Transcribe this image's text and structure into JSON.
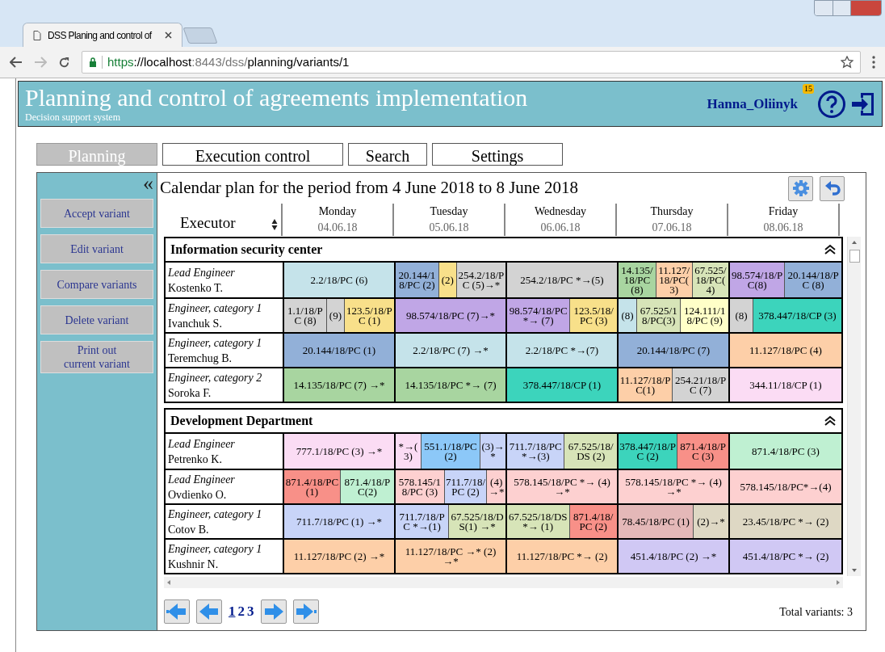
{
  "browser": {
    "tab_title": "DSS Planing and control of",
    "url": [
      {
        "kind": "scheme",
        "text": "https"
      },
      {
        "kind": "host",
        "text": "://localhost"
      },
      {
        "kind": "dim",
        "text": ":8443/dss/"
      },
      {
        "kind": "path",
        "text": "planning/variants/1"
      }
    ]
  },
  "header": {
    "title": "Planning and control of agreements implementation",
    "subtitle": "Decision support system",
    "user": "Hanna_Oliinyk",
    "notifications": "15"
  },
  "nav": [
    {
      "label": "Planning",
      "selected": true
    },
    {
      "label": "Execution control",
      "selected": false
    },
    {
      "label": "Search",
      "selected": false
    },
    {
      "label": "Settings",
      "selected": false
    }
  ],
  "sidebar": {
    "collapse": "«",
    "buttons": [
      "Accept variant",
      "Edit variant",
      "Compare variants",
      "Delete variant",
      "Print out\ncurrent variant"
    ]
  },
  "plan": {
    "title": "Calendar plan for the period from 4 June 2018 to 8 June 2018",
    "executor_label": "Executor",
    "days": [
      {
        "day": "Monday",
        "date": "04.06.18"
      },
      {
        "day": "Tuesday",
        "date": "05.06.18"
      },
      {
        "day": "Wednesday",
        "date": "06.06.18"
      },
      {
        "day": "Thursday",
        "date": "07.06.18"
      },
      {
        "day": "Friday",
        "date": "08.06.18"
      }
    ],
    "groups": [
      {
        "name": "Information security center",
        "expanded": true,
        "rows": [
          {
            "position": "Lead Engineer",
            "name": "Kostenko T.",
            "days": [
              [
                {
                  "text": "2.2/18/PC (6)",
                  "color": "#c5e3ea"
                }
              ],
              [
                {
                  "text": "20.144/18/PC (2)",
                  "color": "#92b0d8"
                },
                {
                  "text": "(2)",
                  "color": "#f8e08a"
                },
                {
                  "text": "254.2/18/PC (5)→*",
                  "color": "#d3d3d3"
                }
              ],
              [
                {
                  "text": "254.2/18/PC *→(5)",
                  "color": "#d3d3d3"
                }
              ],
              [
                {
                  "text": "14.135/18/PC (8)",
                  "color": "#a8d5a0"
                },
                {
                  "text": "11.127/18/PC(3)",
                  "color": "#fdcfa8"
                },
                {
                  "text": "67.525/18/PC(4)",
                  "color": "#d7e4b8"
                }
              ],
              [
                {
                  "text": "98.574/18/PC(8)",
                  "color": "#c0a6e6"
                },
                {
                  "text": "20.144/18/PC (8)",
                  "color": "#92b0d8"
                }
              ]
            ]
          },
          {
            "position": "Engineer, category 1",
            "name": "Ivanchuk S.",
            "days": [
              [
                {
                  "text": "1.1/18/PC (8)",
                  "color": "#d3d3d3"
                },
                {
                  "text": "(9)",
                  "color": "#d3d3d3"
                },
                {
                  "text": "123.5/18/PC (1)",
                  "color": "#f8e08a"
                }
              ],
              [
                {
                  "text": "98.574/18/PC (7)→*",
                  "color": "#c0a6e6"
                }
              ],
              [
                {
                  "text": "98.574/18/PC *→ (7)",
                  "color": "#c0a6e6"
                },
                {
                  "text": "123.5/18/PC (3)",
                  "color": "#f8e08a"
                }
              ],
              [
                {
                  "text": "(8)",
                  "color": "#c5e3ea"
                },
                {
                  "text": "67.525/18/PC(3)",
                  "color": "#d7e4b8"
                },
                {
                  "text": "124.111/18/PC (9)",
                  "color": "#ffffc8"
                }
              ],
              [
                {
                  "text": "(8)",
                  "color": "#d3d3d3"
                },
                {
                  "text": "378.447/18/CP (3)",
                  "color": "#3cd4bc"
                }
              ]
            ]
          },
          {
            "position": "Engineer, category 1",
            "name": "Teremchug B.",
            "days": [
              [
                {
                  "text": "20.144/18/PC (1)",
                  "color": "#92b0d8"
                }
              ],
              [
                {
                  "text": "2.2/18/PC (7) →*",
                  "color": "#c5e3ea"
                }
              ],
              [
                {
                  "text": "2.2/18/PC *→(7)",
                  "color": "#c5e3ea"
                }
              ],
              [
                {
                  "text": "20.144/18/PC (7)",
                  "color": "#92b0d8"
                }
              ],
              [
                {
                  "text": "11.127/18/PC (4)",
                  "color": "#fdcfa8"
                }
              ]
            ]
          },
          {
            "position": "Engineer, category 2",
            "name": "Soroka F.",
            "days": [
              [
                {
                  "text": "14.135/18/PC (7) →*",
                  "color": "#a8d5a0"
                }
              ],
              [
                {
                  "text": "14.135/18/PC *→ (7)",
                  "color": "#a8d5a0"
                }
              ],
              [
                {
                  "text": "378.447/18/CP (1)",
                  "color": "#3cd4bc"
                }
              ],
              [
                {
                  "text": "11.127/18/PC(1)",
                  "color": "#fdcfa8"
                },
                {
                  "text": "254.21/18/PC (7)",
                  "color": "#d3d3d3"
                }
              ],
              [
                {
                  "text": "344.11/18/CP (1)",
                  "color": "#fbdcf4"
                }
              ]
            ]
          }
        ]
      },
      {
        "name": "Development Department",
        "expanded": true,
        "rows": [
          {
            "position": "Lead Engineer",
            "name": "Petrenko K.",
            "days": [
              [
                {
                  "text": "777.1/18/PC (3) →*",
                  "color": "#fbdcf4"
                }
              ],
              [
                {
                  "text": "*→(3)",
                  "color": "#fbdcf4"
                },
                {
                  "text": "551.1/18/PC (2)",
                  "color": "#8cc8f8"
                },
                {
                  "text": "(3)→*",
                  "color": "#c8d4f8"
                }
              ],
              [
                {
                  "text": "711.7/18/PC*→(3)",
                  "color": "#c8d4f8"
                },
                {
                  "text": "67.525/18/DS (2)",
                  "color": "#d7e4b8"
                }
              ],
              [
                {
                  "text": "378.447/18/PC (2)",
                  "color": "#3cd4bc"
                },
                {
                  "text": "871.4/18/PC (3)",
                  "color": "#f89088"
                }
              ],
              [
                {
                  "text": "871.4/18/PC (3)",
                  "color": "#bff0d2"
                }
              ]
            ]
          },
          {
            "position": "Lead Engineer",
            "name": "Ovdienko O.",
            "days": [
              [
                {
                  "text": "871.4/18/PC (1)",
                  "color": "#f89088"
                },
                {
                  "text": "871.4/18/PC(2)",
                  "color": "#bff0d2"
                }
              ],
              [
                {
                  "text": "578.145/18/PC (3)",
                  "color": "#fdd0d0"
                },
                {
                  "text": "711.7/18/PC (2)",
                  "color": "#c8d4f8"
                },
                {
                  "text": "(4)→*",
                  "color": "#fdd0d0"
                }
              ],
              [
                {
                  "text": "578.145/18/PC *→ (4) →*",
                  "color": "#fdd0d0"
                }
              ],
              [
                {
                  "text": "578.145/18/PC *→ (4) →*",
                  "color": "#fdd0d0"
                }
              ],
              [
                {
                  "text": "578.145/18/PC*→(4)",
                  "color": "#fdd0d0"
                }
              ]
            ]
          },
          {
            "position": "Engineer, category 1",
            "name": "Cotov B.",
            "days": [
              [
                {
                  "text": "711.7/18/PC (1) →*",
                  "color": "#c8d4f8"
                }
              ],
              [
                {
                  "text": "711.7/18/PC *→(1)",
                  "color": "#c8d4f8"
                },
                {
                  "text": "67.525/18/DS(1) →*",
                  "color": "#d7e4b8"
                }
              ],
              [
                {
                  "text": "67.525/18/DS*→ (1)",
                  "color": "#d7e4b8"
                },
                {
                  "text": "871.4/18/PC (2)",
                  "color": "#f89088"
                }
              ],
              [
                {
                  "text": "78.45/18/PC (1)",
                  "color": "#e4b8b8"
                },
                {
                  "text": "(2)→*",
                  "color": "#ded8c4"
                }
              ],
              [
                {
                  "text": "23.45/18/PC *→ (2)",
                  "color": "#ded8c4"
                }
              ]
            ]
          },
          {
            "position": "Engineer, category 1",
            "name": "Kushnir N.",
            "days": [
              [
                {
                  "text": "11.127/18/PC (2) →*",
                  "color": "#fdcfa8"
                }
              ],
              [
                {
                  "text": "11.127/18/PC →* (2) →*",
                  "color": "#fdcfa8"
                }
              ],
              [
                {
                  "text": "11.127/18/PC *→ (2)",
                  "color": "#fdcfa8"
                }
              ],
              [
                {
                  "text": "451.4/18/PC (2) →*",
                  "color": "#d0c8f4"
                }
              ],
              [
                {
                  "text": "451.4/18/PC *→ (2)",
                  "color": "#d0c8f4"
                }
              ]
            ]
          }
        ]
      }
    ],
    "pages": [
      {
        "label": "1",
        "selected": true
      },
      {
        "label": "2",
        "selected": false
      },
      {
        "label": "3",
        "selected": false
      }
    ],
    "total": "Total variants: 3"
  }
}
